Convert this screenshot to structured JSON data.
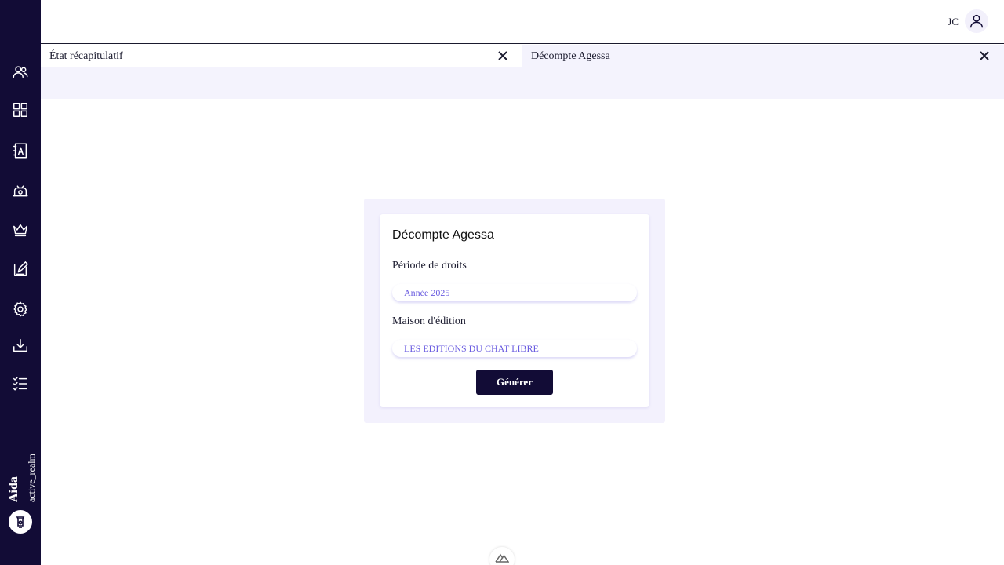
{
  "sidebar": {
    "icons": [
      "users-icon",
      "dashboard-grid-icon",
      "contacts-book-icon",
      "payment-icon",
      "crown-icon",
      "contract-edit-icon",
      "settings-gear-icon",
      "download-icon",
      "checklist-icon"
    ],
    "brand_name": "Aida",
    "realm": "active_realm"
  },
  "header": {
    "user_initials": "JC"
  },
  "tabs": [
    {
      "label": "État récapitulatif",
      "active": true
    },
    {
      "label": "Décompte Agessa",
      "active": false
    }
  ],
  "form": {
    "title": "Décompte Agessa",
    "period_label": "Période de droits",
    "period_value": "Année 2025",
    "publisher_label": "Maison d'édition",
    "publisher_value": "LES EDITIONS DU CHAT LIBRE",
    "submit_label": "Générer"
  },
  "colors": {
    "sidebar_bg": "#120c36",
    "accent_text": "#6a5ce0",
    "tabbar_bg": "#f4f3fd"
  }
}
